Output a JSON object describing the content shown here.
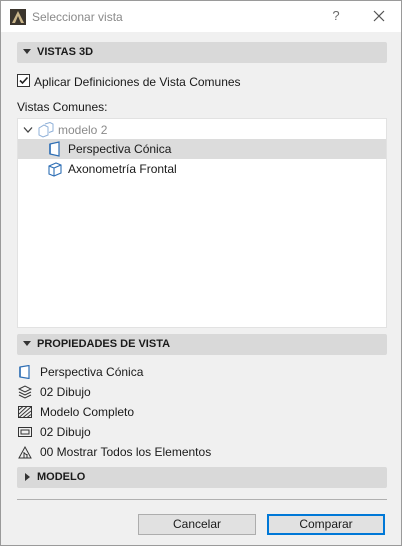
{
  "window": {
    "title": "Seleccionar vista",
    "help_label": "?"
  },
  "sections": {
    "vistas3d": {
      "label": "VISTAS 3D",
      "expanded": true
    },
    "propiedades": {
      "label": "PROPIEDADES DE VISTA",
      "expanded": true
    },
    "modelo": {
      "label": "MODELO",
      "expanded": false
    }
  },
  "apply_common": {
    "label": "Aplicar Definiciones de Vista Comunes",
    "checked": true
  },
  "common_views": {
    "label": "Vistas Comunes:",
    "root": "modelo 2",
    "items": [
      {
        "label": "Perspectiva Cónica",
        "selected": true,
        "icon": "perspective-view-icon"
      },
      {
        "label": "Axonometría Frontal",
        "selected": false,
        "icon": "axonometric-view-icon"
      }
    ]
  },
  "properties": [
    {
      "label": "Perspectiva Cónica",
      "icon": "perspective-view-icon"
    },
    {
      "label": "02 Dibujo",
      "icon": "layer-combination-icon"
    },
    {
      "label": "Modelo Completo",
      "icon": "model-view-options-icon"
    },
    {
      "label": "02 Dibujo",
      "icon": "pen-set-icon"
    },
    {
      "label": "00 Mostrar Todos los Elementos",
      "icon": "renovation-filter-icon"
    }
  ],
  "buttons": {
    "cancel": "Cancelar",
    "confirm": "Comparar"
  },
  "colors": {
    "accent": "#0078d7",
    "selection": "#dcdcdc",
    "section_header": "#d9d9d9",
    "view_icon": "#2f6fb5"
  }
}
